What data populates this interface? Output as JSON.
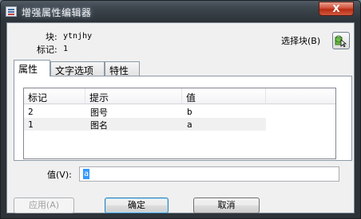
{
  "window": {
    "title": "增强属性编辑器",
    "close_glyph": "X"
  },
  "info": {
    "block_label": "块:",
    "block_value": "ytnjhy",
    "tag_label": "标记:",
    "tag_value": "1"
  },
  "pick_block": {
    "label": "选择块(B)",
    "icon": "pick-object-icon"
  },
  "tabs": [
    {
      "label": "属性",
      "active": true
    },
    {
      "label": "文字选项",
      "active": false
    },
    {
      "label": "特性",
      "active": false
    }
  ],
  "table": {
    "columns": [
      "标记",
      "提示",
      "值"
    ],
    "rows": [
      {
        "tag": "2",
        "prompt": "图号",
        "value": "b",
        "selected": false
      },
      {
        "tag": "1",
        "prompt": "图名",
        "value": "a",
        "selected": true
      }
    ]
  },
  "value_field": {
    "label": "值(V):",
    "value": "a"
  },
  "buttons": {
    "apply": "应用(A)",
    "ok": "确定",
    "cancel": "取消"
  },
  "colors": {
    "selection": "#3399ff",
    "row_highlight": "#f0f0f0",
    "close_red": "#c8351c"
  }
}
